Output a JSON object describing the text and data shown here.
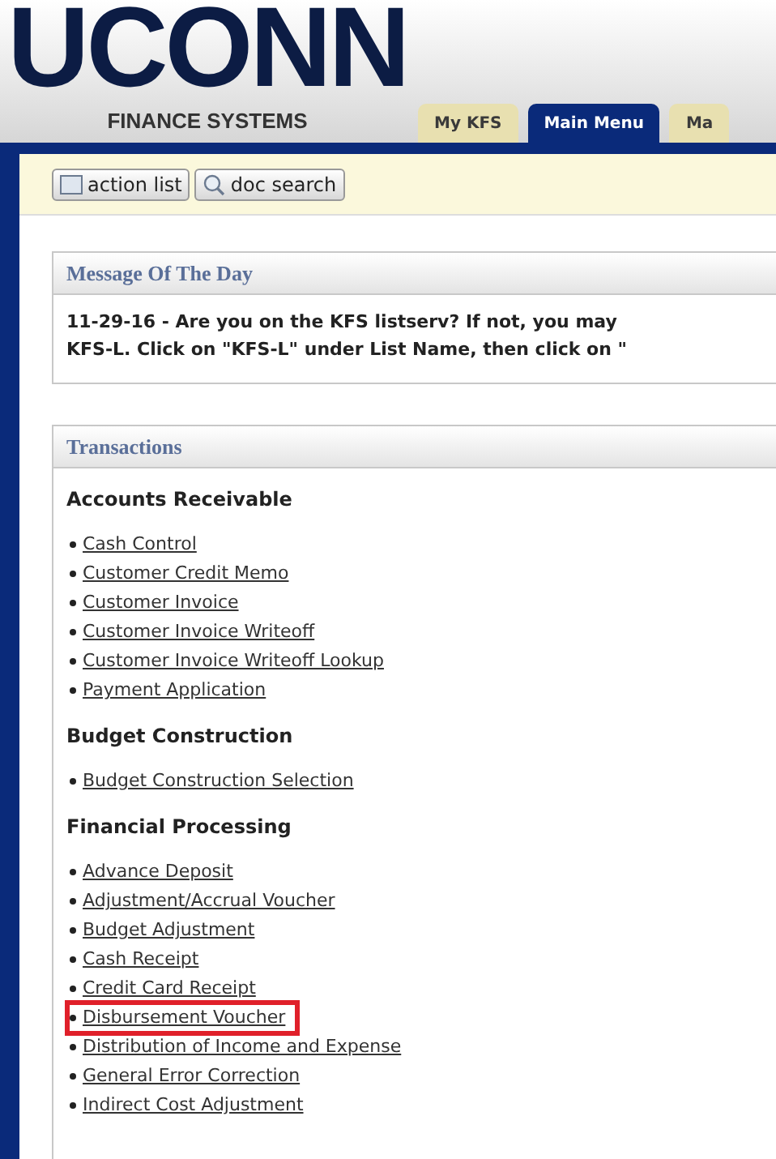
{
  "header": {
    "logo": "UCONN",
    "subtitle": "FINANCE SYSTEMS"
  },
  "tabs": [
    {
      "label": "My KFS",
      "selected": false
    },
    {
      "label": "Main Menu",
      "selected": true
    },
    {
      "label": "Ma",
      "selected": false
    }
  ],
  "toolbar": {
    "buttons": [
      {
        "label": "action list",
        "kind": "list"
      },
      {
        "label": "doc search",
        "kind": "search"
      }
    ]
  },
  "message_panel": {
    "title": "Message Of The Day",
    "lines": [
      "11-29-16 - Are you on the KFS listserv? If not, you may",
      "KFS-L. Click on \"KFS-L\" under List Name, then click on \""
    ]
  },
  "transactions_panel": {
    "title": "Transactions",
    "sections": [
      {
        "heading": "Accounts Receivable",
        "items": [
          {
            "label": "Cash Control",
            "highlighted": false
          },
          {
            "label": "Customer Credit Memo",
            "highlighted": false
          },
          {
            "label": "Customer Invoice",
            "highlighted": false
          },
          {
            "label": "Customer Invoice Writeoff",
            "highlighted": false
          },
          {
            "label": "Customer Invoice Writeoff Lookup",
            "highlighted": false
          },
          {
            "label": "Payment Application",
            "highlighted": false
          }
        ]
      },
      {
        "heading": "Budget Construction",
        "items": [
          {
            "label": "Budget Construction Selection",
            "highlighted": false
          }
        ]
      },
      {
        "heading": "Financial Processing",
        "items": [
          {
            "label": "Advance Deposit",
            "highlighted": false
          },
          {
            "label": "Adjustment/Accrual Voucher",
            "highlighted": false
          },
          {
            "label": "Budget Adjustment",
            "highlighted": false
          },
          {
            "label": "Cash Receipt",
            "highlighted": false
          },
          {
            "label": "Credit Card Receipt",
            "highlighted": false
          },
          {
            "label": "Disbursement Voucher",
            "highlighted": true
          },
          {
            "label": "Distribution of Income and Expense",
            "highlighted": false
          },
          {
            "label": "General Error Correction",
            "highlighted": false
          },
          {
            "label": "Indirect Cost Adjustment",
            "highlighted": false
          }
        ]
      }
    ]
  }
}
